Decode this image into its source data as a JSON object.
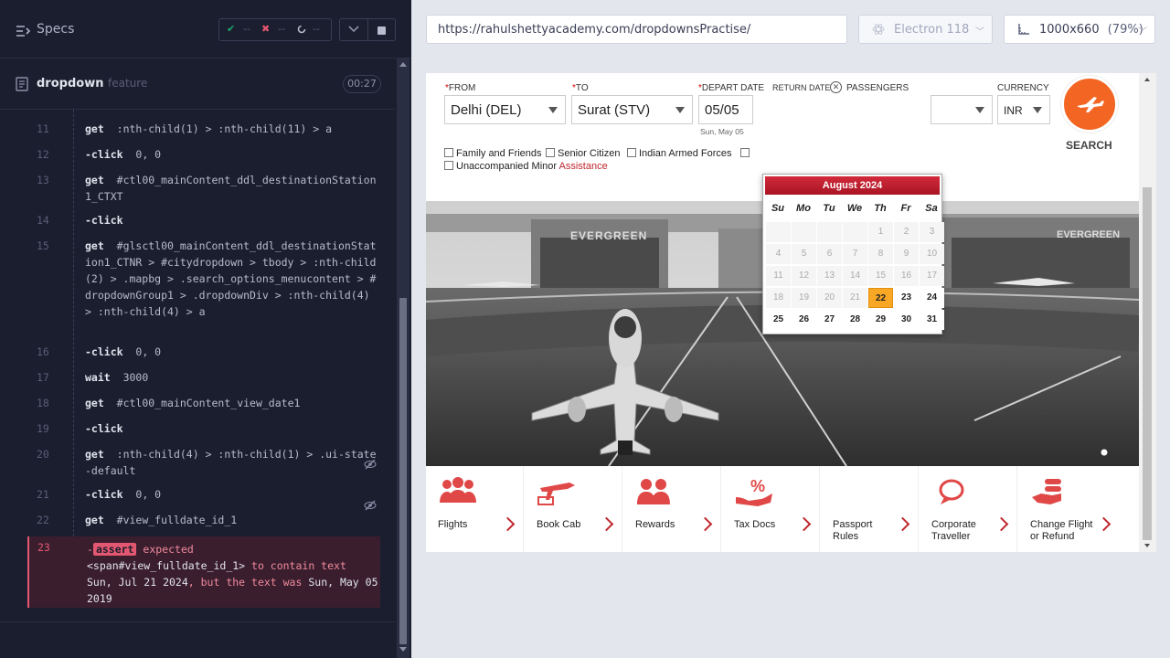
{
  "runner": {
    "specs_label": "Specs",
    "stats": {
      "passed": "--",
      "failed": "--",
      "pending": "--"
    },
    "test_title": "dropdown",
    "test_feature": "feature",
    "test_time": "00:27",
    "commands": [
      {
        "num": "11",
        "name": "get",
        "arg": ":nth-child(1) > :nth-child(11) > a"
      },
      {
        "num": "12",
        "name": "-click",
        "arg": "0, 0"
      },
      {
        "num": "13",
        "name": "get",
        "arg": "#ctl00_mainContent_ddl_destinationStation1_CTXT"
      },
      {
        "num": "14",
        "name": "-click",
        "arg": ""
      },
      {
        "num": "15",
        "name": "get",
        "arg": "#glsctl00_mainContent_ddl_destinationStation1_CTNR > #citydropdown > tbody > :nth-child(2) > .mapbg > .search_options_menucontent > #dropdownGroup1 > .dropdownDiv > :nth-child(4) > :nth-child(4) > a"
      },
      {
        "num": "16",
        "name": "-click",
        "arg": "0, 0"
      },
      {
        "num": "17",
        "name": "wait",
        "arg": "3000"
      },
      {
        "num": "18",
        "name": "get",
        "arg": "#ctl00_mainContent_view_date1"
      },
      {
        "num": "19",
        "name": "-click",
        "arg": ""
      },
      {
        "num": "20",
        "name": "get",
        "arg": ":nth-child(4) > :nth-child(1) > .ui-state-default"
      },
      {
        "num": "21",
        "name": "-click",
        "arg": "0, 0"
      },
      {
        "num": "22",
        "name": "get",
        "arg": "#view_fulldate_id_1"
      }
    ],
    "assert": {
      "num": "23",
      "badge": "assert",
      "pre": " expected",
      "selector": "<span#view_fulldate_id_1>",
      "mid": " to contain text",
      "expected": "Sun, Jul 21 2024",
      "mid2": ", but the text was",
      "actual": "Sun, May 05 2019"
    }
  },
  "browser": {
    "url": "https://rahulshettyacademy.com/dropdownsPractise/",
    "browser_name": "Electron 118",
    "viewport": "1000x660",
    "zoom": "(79%)"
  },
  "form": {
    "from_label": "FROM",
    "to_label": "TO",
    "depart_label": "DEPART DATE",
    "return_label": "RETURN DATE",
    "passengers_label": "PASSENGERS",
    "currency_label": "CURRENCY",
    "from_value": "Delhi (DEL)",
    "to_value": "Surat (STV)",
    "depart_value": "05/05",
    "depart_sub": "Sun, May 05",
    "currency_value": "INR",
    "search_label": "SEARCH",
    "checkboxes": [
      "Family and Friends",
      "Senior Citizen",
      "Indian Armed Forces",
      "Unaccompanied Minor"
    ],
    "assistance": "Assistance"
  },
  "datepicker": {
    "month": "August 2024",
    "weekdays": [
      "Su",
      "Mo",
      "Tu",
      "We",
      "Th",
      "Fr",
      "Sa"
    ],
    "rows": [
      [
        "",
        "",
        "",
        "",
        "1",
        "2",
        "3"
      ],
      [
        "4",
        "5",
        "6",
        "7",
        "8",
        "9",
        "10"
      ],
      [
        "11",
        "12",
        "13",
        "14",
        "15",
        "16",
        "17"
      ],
      [
        "18",
        "19",
        "20",
        "21",
        "22",
        "23",
        "24"
      ],
      [
        "25",
        "26",
        "27",
        "28",
        "29",
        "30",
        "31"
      ]
    ],
    "selected": "22"
  },
  "services": [
    {
      "label": "Flights"
    },
    {
      "label": "Book Cab"
    },
    {
      "label": "Rewards"
    },
    {
      "label": "Tax Docs"
    },
    {
      "label": "Passport\nRules"
    },
    {
      "label": "Corporate\nTraveller"
    },
    {
      "label": "Change Flight\nor Refund"
    }
  ],
  "hero": {
    "hangar_left": "EVERGREEN",
    "hangar_right": "EVERGREEN"
  },
  "colors": {
    "accent_red": "#c0272d",
    "search_orange": "#f26522",
    "runner_bg": "#1b1e2e"
  }
}
